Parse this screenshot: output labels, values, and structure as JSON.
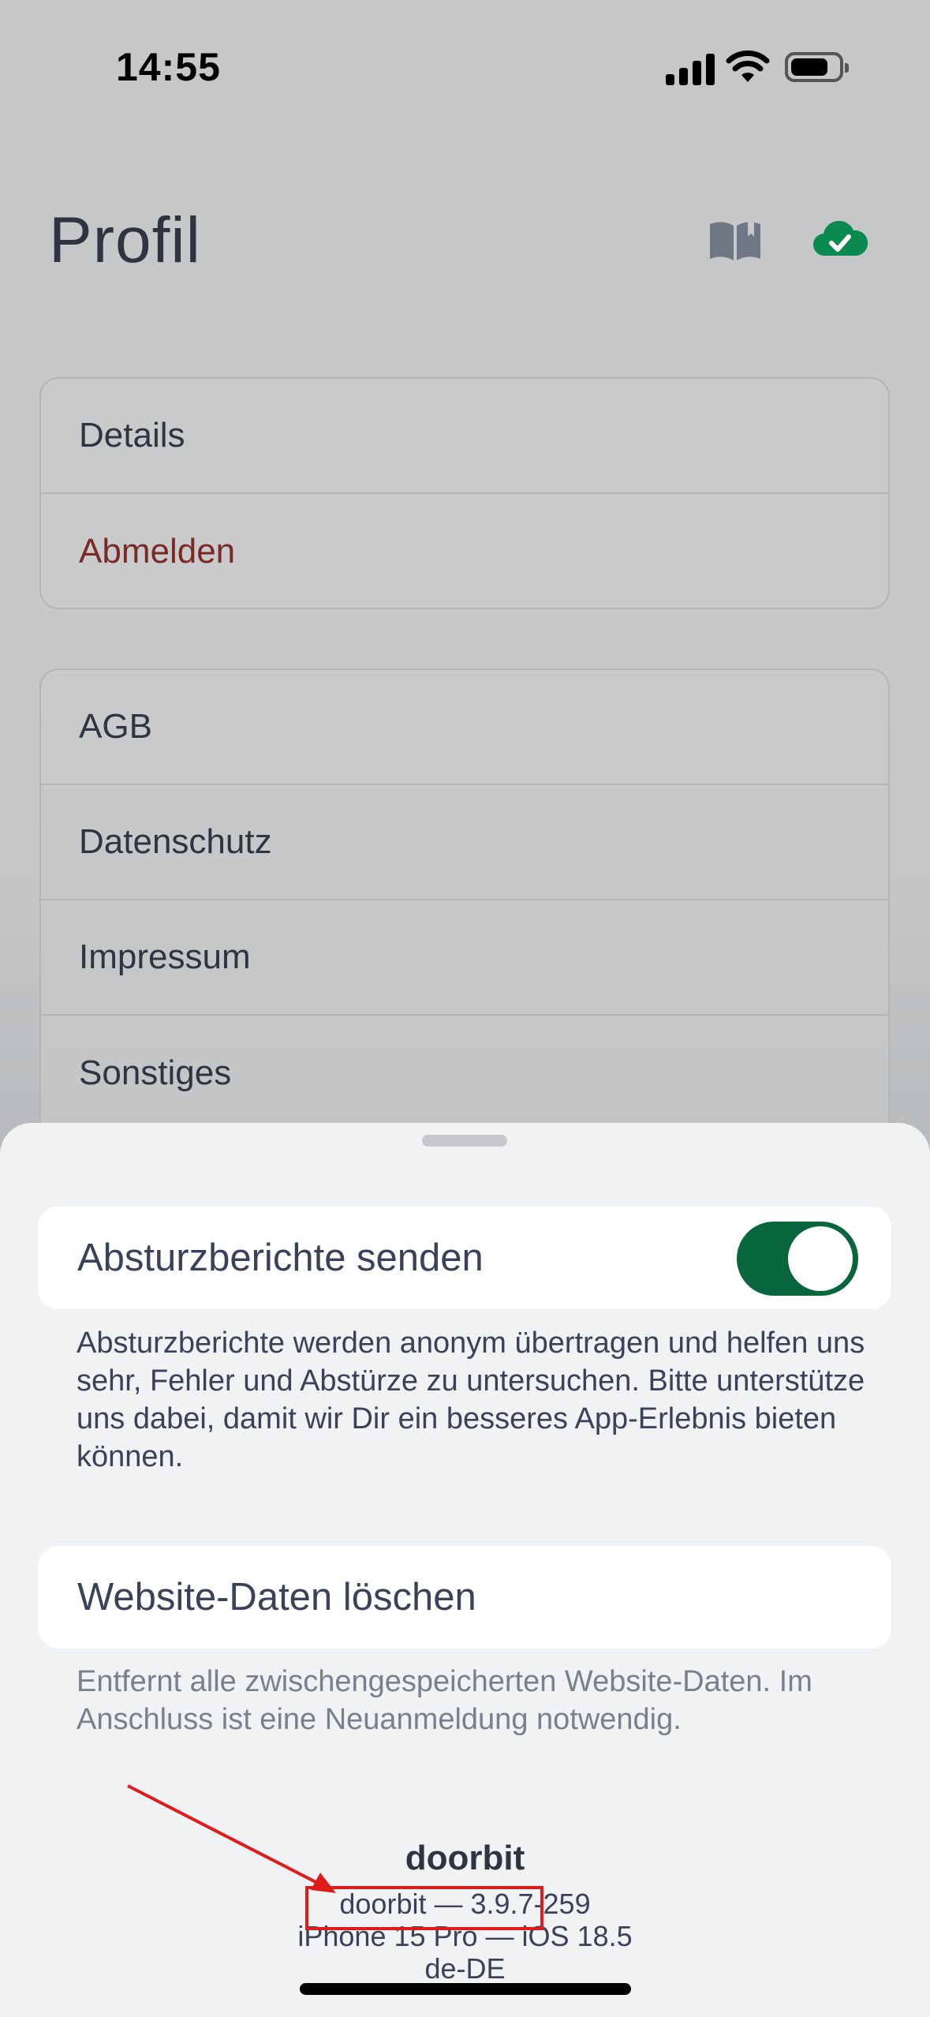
{
  "status_bar": {
    "time": "14:55"
  },
  "header": {
    "title": "Profil",
    "icons": [
      "book-open-icon",
      "cloud-check-icon"
    ]
  },
  "account_card": {
    "items": [
      {
        "label": "Details"
      },
      {
        "label": "Abmelden"
      }
    ]
  },
  "legal_card": {
    "items": [
      {
        "label": "AGB"
      },
      {
        "label": "Datenschutz"
      },
      {
        "label": "Impressum"
      },
      {
        "label": "Sonstiges"
      }
    ]
  },
  "sheet": {
    "crash_reports": {
      "label": "Absturzberichte senden",
      "enabled": true,
      "description": "Absturzberichte werden anonym übertragen und helfen uns sehr, Fehler und Abstürze zu untersuchen. Bitte unterstütze uns dabei, damit wir Dir ein besseres App-Erlebnis bieten können."
    },
    "website_data": {
      "label": "Website-Daten löschen",
      "description": "Entfernt alle zwischengespeicherten Website-Daten. Im Anschluss ist eine Neuanmeldung notwendig."
    },
    "footer": {
      "brand": "doorbit",
      "version": "doorbit — 3.9.7-259",
      "device": "iPhone 15 Pro — iOS 18.5",
      "locale": "de-DE"
    }
  },
  "colors": {
    "toggle_on": "#07663d",
    "danger": "#7a2a22",
    "cloud": "#0a8a4e",
    "annotation": "#e01b1b"
  }
}
